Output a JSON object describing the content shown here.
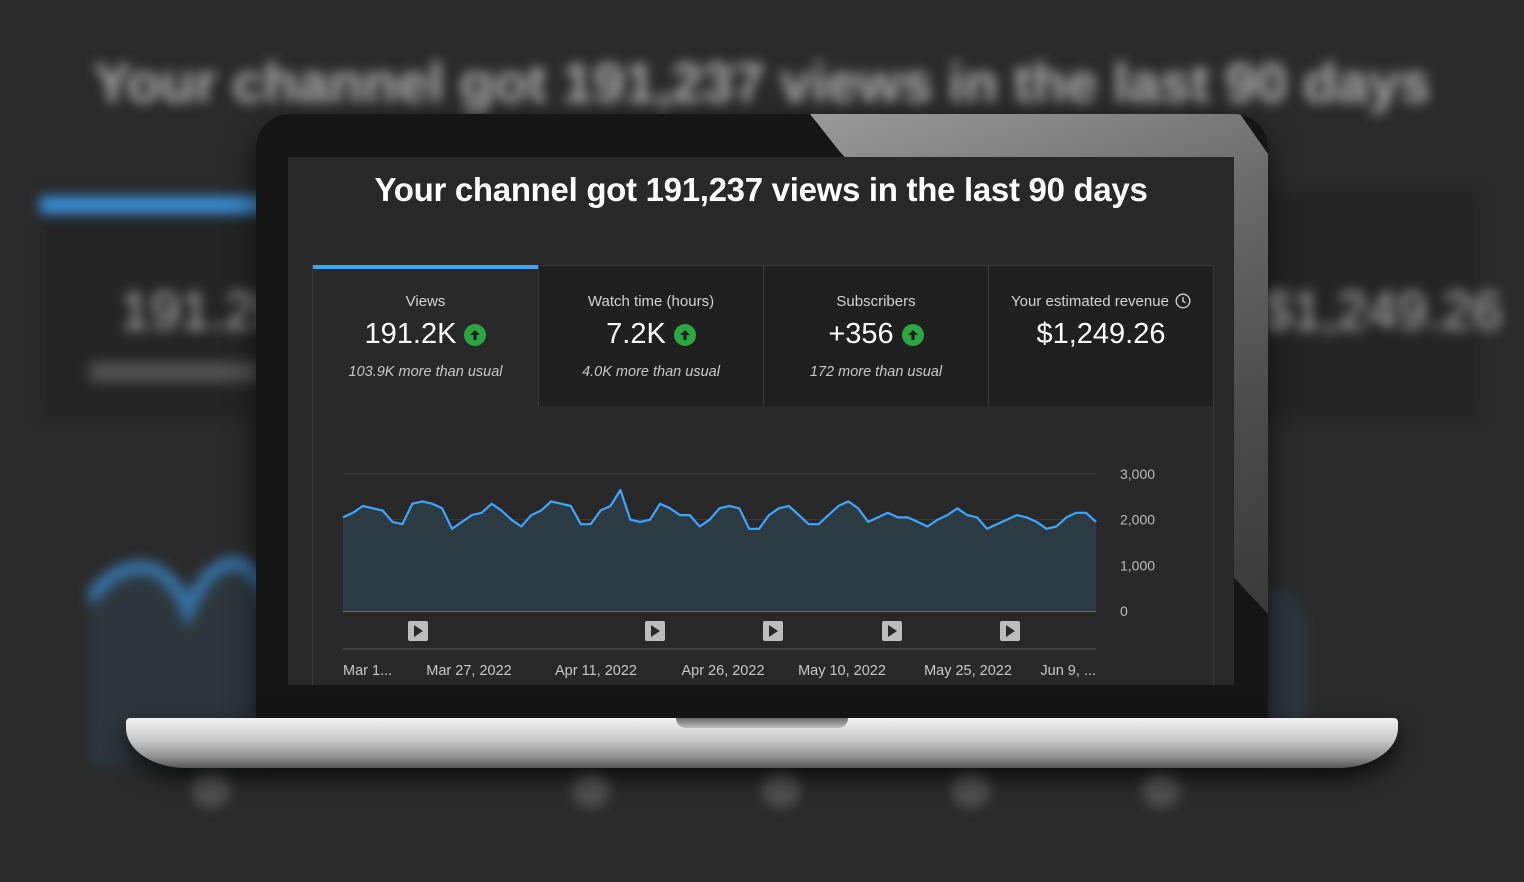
{
  "background": {
    "title": "Your channel got 191,237 views in the last 90 days",
    "left_metric_value": "191.2K",
    "right_metric_value": "$1,249.26"
  },
  "screen": {
    "title": "Your channel got 191,237 views in the last 90 days",
    "tabs": [
      {
        "label": "Views",
        "value": "191.2K",
        "note": "103.9K more than usual",
        "trend": "up",
        "active": true
      },
      {
        "label": "Watch time (hours)",
        "value": "7.2K",
        "note": "4.0K more than usual",
        "trend": "up",
        "active": false
      },
      {
        "label": "Subscribers",
        "value": "+356",
        "note": "172 more than usual",
        "trend": "up",
        "active": false
      },
      {
        "label": "Your estimated revenue",
        "value": "$1,249.26",
        "note": "",
        "trend": "",
        "active": false,
        "info_icon": "clock-icon"
      }
    ]
  },
  "colors": {
    "accent": "#3ea6ff",
    "positive": "#2ba640",
    "line": "#3ea6ff"
  },
  "chart_data": {
    "type": "area",
    "title": "",
    "xlabel": "",
    "ylabel": "",
    "ylim": [
      0,
      3000
    ],
    "yticks": [
      "3,000",
      "2,000",
      "1,000",
      "0"
    ],
    "x_tick_labels": [
      "Mar 1...",
      "Mar 27, 2022",
      "Apr 11, 2022",
      "Apr 26, 2022",
      "May 10, 2022",
      "May 25, 2022",
      "Jun 9, ..."
    ],
    "grid": true,
    "video_markers": 5,
    "series": [
      {
        "values": [
          2050,
          2150,
          2300,
          2250,
          2200,
          1950,
          1900,
          2350,
          2400,
          2350,
          2250,
          1800,
          1950,
          2100,
          2150,
          2350,
          2200,
          2000,
          1850,
          2100,
          2200,
          2400,
          2350,
          2300,
          1900,
          1900,
          2200,
          2300,
          2650,
          2000,
          1950,
          2000,
          2350,
          2250,
          2100,
          2100,
          1850,
          2000,
          2250,
          2300,
          2250,
          1800,
          1800,
          2100,
          2250,
          2300,
          2100,
          1900,
          1900,
          2100,
          2300,
          2400,
          2250,
          1950,
          2050,
          2150,
          2050,
          2050,
          1950,
          1850,
          2000,
          2100,
          2250,
          2100,
          2050,
          1800,
          1900,
          2000,
          2100,
          2050,
          1950,
          1800,
          1850,
          2050,
          2150,
          2150,
          1950
        ]
      }
    ]
  }
}
